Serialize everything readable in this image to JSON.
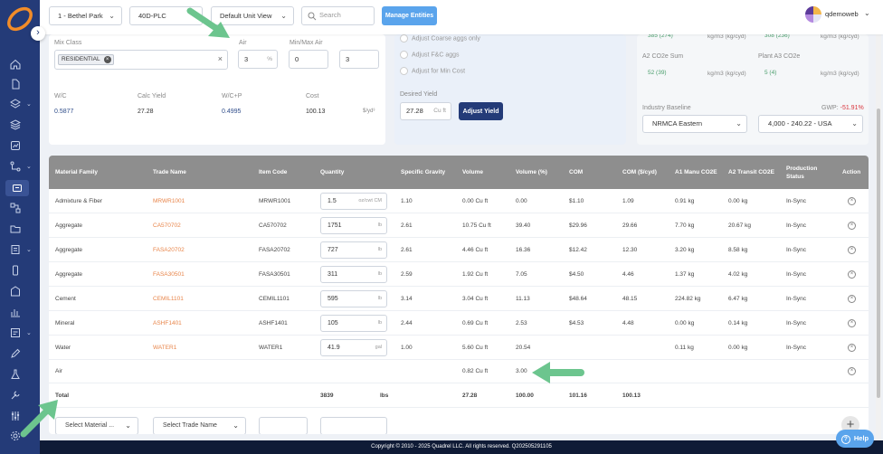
{
  "topbar": {
    "location": "1 - Bethel Park",
    "plant": "40D-PLC",
    "unit_view": "Default Unit View",
    "search_placeholder": "Search",
    "manage_button": "Manage Entities",
    "username": "qdemoweb"
  },
  "mix": {
    "mix_class_label": "Mix Class",
    "mix_class_chip": "RESIDENTIAL",
    "air_label": "Air",
    "air_value": "3",
    "air_unit": "%",
    "minmax_label": "Min/Max Air",
    "min_air": "0",
    "max_air": "3",
    "wc_label": "W/C",
    "wc_value": "0.5877",
    "calc_yield_label": "Calc Yield",
    "calc_yield_value": "27.28",
    "wcp_label": "W/C+P",
    "wcp_value": "0.4995",
    "cost_label": "Cost",
    "cost_value": "100.13",
    "cost_unit": "$/yd³"
  },
  "adjust": {
    "options": [
      "Adjust Coarse aggs only",
      "Adjust F&C aggs",
      "Adjust for Min Cost"
    ],
    "desired_yield_label": "Desired Yield",
    "desired_yield_value": "27.28",
    "desired_yield_unit": "Cu ft",
    "adjust_button": "Adjust Yield"
  },
  "co2": {
    "top_left_value": "385 (274)",
    "top_left_unit": "kg/m3 (kg/cyd)",
    "top_right_value": "308 (236)",
    "top_right_unit": "kg/m3 (kg/cyd)",
    "a2_label": "A2 CO2e Sum",
    "a2_value": "52 (39)",
    "a2_unit": "kg/m3 (kg/cyd)",
    "a3_label": "Plant A3 CO2e",
    "a3_value": "5 (4)",
    "a3_unit": "kg/m3 (kg/cyd)",
    "baseline_label": "Industry Baseline",
    "gwp_label": "GWP:",
    "gwp_value": "-51.91%",
    "baseline_select": "NRMCA Eastern",
    "baseline_range": "4,000 - 240.22 - USA"
  },
  "table": {
    "headers": [
      "Material Family",
      "Trade Name",
      "Item Code",
      "Quantity",
      "Specific Gravity",
      "Volume",
      "Volume (%)",
      "COM",
      "COM ($/cyd)",
      "A1 Manu CO2E",
      "A2 Transit CO2E",
      "Production Status",
      "Action"
    ],
    "rows": [
      {
        "family": "Admixture & Fiber",
        "trade": "MRWR1001",
        "code": "MRWR1001",
        "qty": "1.5",
        "unit": "oz/cwt CM",
        "sg": "1.10",
        "vol": "0.00 Cu ft",
        "volpct": "0.00",
        "com": "$1.10",
        "comcyd": "1.09",
        "a1": "0.91 kg",
        "a2": "0.00 kg",
        "status": "In-Sync"
      },
      {
        "family": "Aggregate",
        "trade": "CA570702",
        "code": "CA570702",
        "qty": "1751",
        "unit": "lb",
        "sg": "2.61",
        "vol": "10.75 Cu ft",
        "volpct": "39.40",
        "com": "$29.96",
        "comcyd": "29.66",
        "a1": "7.70 kg",
        "a2": "20.67 kg",
        "status": "In-Sync"
      },
      {
        "family": "Aggregate",
        "trade": "FASA20702",
        "code": "FASA20702",
        "qty": "727",
        "unit": "lb",
        "sg": "2.61",
        "vol": "4.46 Cu ft",
        "volpct": "16.36",
        "com": "$12.42",
        "comcyd": "12.30",
        "a1": "3.20 kg",
        "a2": "8.58 kg",
        "status": "In-Sync"
      },
      {
        "family": "Aggregate",
        "trade": "FASA30501",
        "code": "FASA30501",
        "qty": "311",
        "unit": "lb",
        "sg": "2.59",
        "vol": "1.92 Cu ft",
        "volpct": "7.05",
        "com": "$4.50",
        "comcyd": "4.46",
        "a1": "1.37 kg",
        "a2": "4.02 kg",
        "status": "In-Sync"
      },
      {
        "family": "Cement",
        "trade": "CEMIL1101",
        "code": "CEMIL1101",
        "qty": "595",
        "unit": "lb",
        "sg": "3.14",
        "vol": "3.04 Cu ft",
        "volpct": "11.13",
        "com": "$48.64",
        "comcyd": "48.15",
        "a1": "224.82 kg",
        "a2": "6.47 kg",
        "status": "In-Sync"
      },
      {
        "family": "Mineral",
        "trade": "ASHF1401",
        "code": "ASHF1401",
        "qty": "105",
        "unit": "lb",
        "sg": "2.44",
        "vol": "0.69 Cu ft",
        "volpct": "2.53",
        "com": "$4.53",
        "comcyd": "4.48",
        "a1": "0.00 kg",
        "a2": "0.14 kg",
        "status": "In-Sync"
      },
      {
        "family": "Water",
        "trade": "WATER1",
        "code": "WATER1",
        "qty": "41.9",
        "unit": "gal",
        "sg": "1.00",
        "vol": "5.60 Cu ft",
        "volpct": "20.54",
        "com": "",
        "comcyd": "",
        "a1": "0.11 kg",
        "a2": "0.00 kg",
        "status": "In-Sync"
      }
    ],
    "air_row": {
      "family": "Air",
      "vol": "0.82 Cu ft",
      "volpct": "3.00"
    },
    "total_row": {
      "label": "Total",
      "qty": "3839",
      "unit": "lbs",
      "vol": "27.28",
      "volpct": "100.00",
      "com": "101.16",
      "comcyd": "100.13"
    },
    "select_material_placeholder": "Select Material ...",
    "select_trade_placeholder": "Select Trade Name"
  },
  "footer": "Copyright © 2010 - 2025 Quadrel LLC. All rights reserved. Q202505291105",
  "help_label": "Help",
  "colors": {
    "sidebar": "#243b78",
    "accent": "#5aa4ec",
    "link": "#e8854a",
    "annotation": "#6cc58e",
    "header": "#8e8e8e"
  }
}
